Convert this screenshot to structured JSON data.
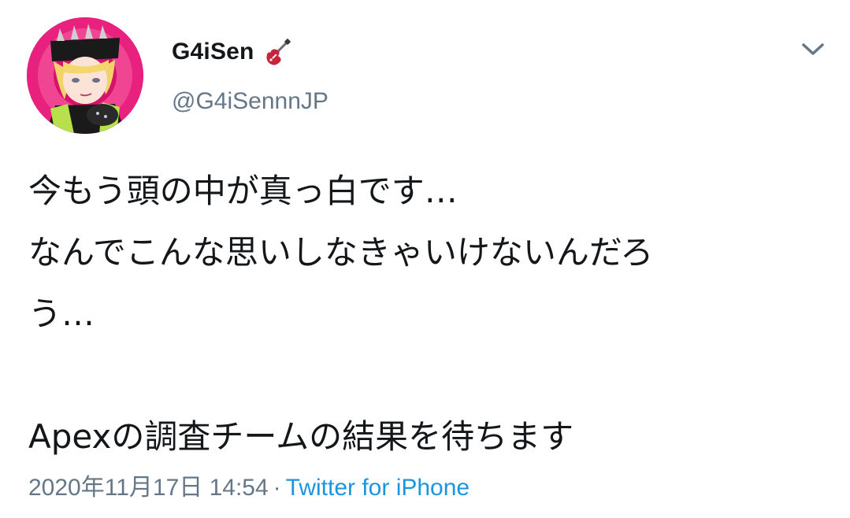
{
  "user": {
    "display_name": "G4iSen",
    "handle": "@G4iSennnJP",
    "name_emoji_icon": "electric-guitar-icon"
  },
  "tweet": {
    "lines": [
      "今もう頭の中が真っ白です…",
      "なんでこんな思いしなきゃいけないんだろ",
      "う…",
      "",
      "Apexの調査チームの結果を待ちます"
    ]
  },
  "meta": {
    "timestamp": "2020年11月17日 14:54",
    "separator": "·",
    "source": "Twitter for iPhone"
  },
  "menu": {
    "icon": "chevron-down-icon"
  },
  "colors": {
    "text_primary": "#14171a",
    "text_secondary": "#657786",
    "link": "#1b95e0",
    "avatar_bg": "#e51e7a"
  }
}
